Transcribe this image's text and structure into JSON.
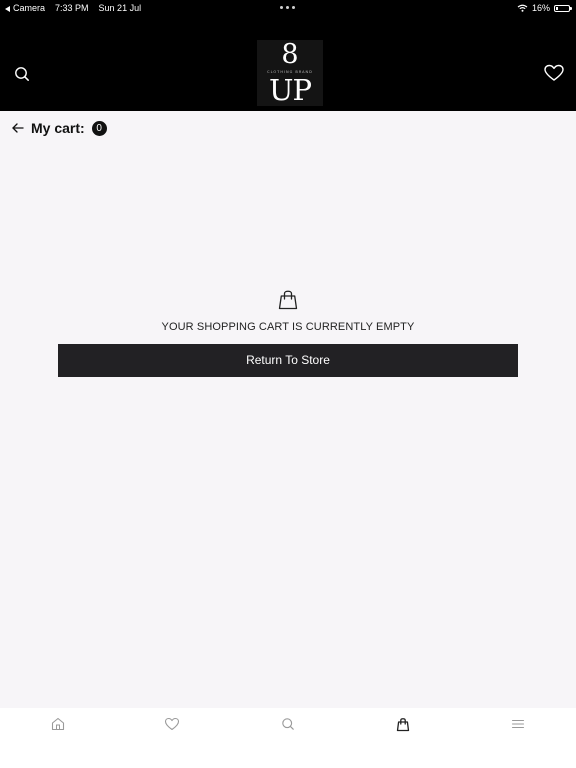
{
  "status_bar": {
    "back_app": "Camera",
    "time": "7:33 PM",
    "date": "Sun 21 Jul",
    "battery_text": "16%",
    "battery_level": 0.16
  },
  "header": {
    "logo": {
      "top": "8",
      "middle": "CLOTHING BRAND",
      "bottom": "UP"
    },
    "icons": {
      "search": "search-icon",
      "favorites": "heart-icon"
    }
  },
  "cart": {
    "title": "My cart:",
    "count": "0",
    "empty_message": "YOUR SHOPPING CART IS CURRENTLY EMPTY",
    "return_label": "Return To Store"
  },
  "tabbar": {
    "items": [
      {
        "name": "home",
        "icon": "home-icon"
      },
      {
        "name": "wishlist",
        "icon": "heart-icon"
      },
      {
        "name": "search",
        "icon": "search-icon"
      },
      {
        "name": "cart",
        "icon": "shopping-bag-icon",
        "active": true
      },
      {
        "name": "menu",
        "icon": "menu-icon"
      }
    ]
  },
  "colors": {
    "header_bg": "#000000",
    "page_bg": "#f7f5f8",
    "button_bg": "#222124",
    "tab_inactive": "#9a9a9a",
    "tab_active": "#222222"
  }
}
